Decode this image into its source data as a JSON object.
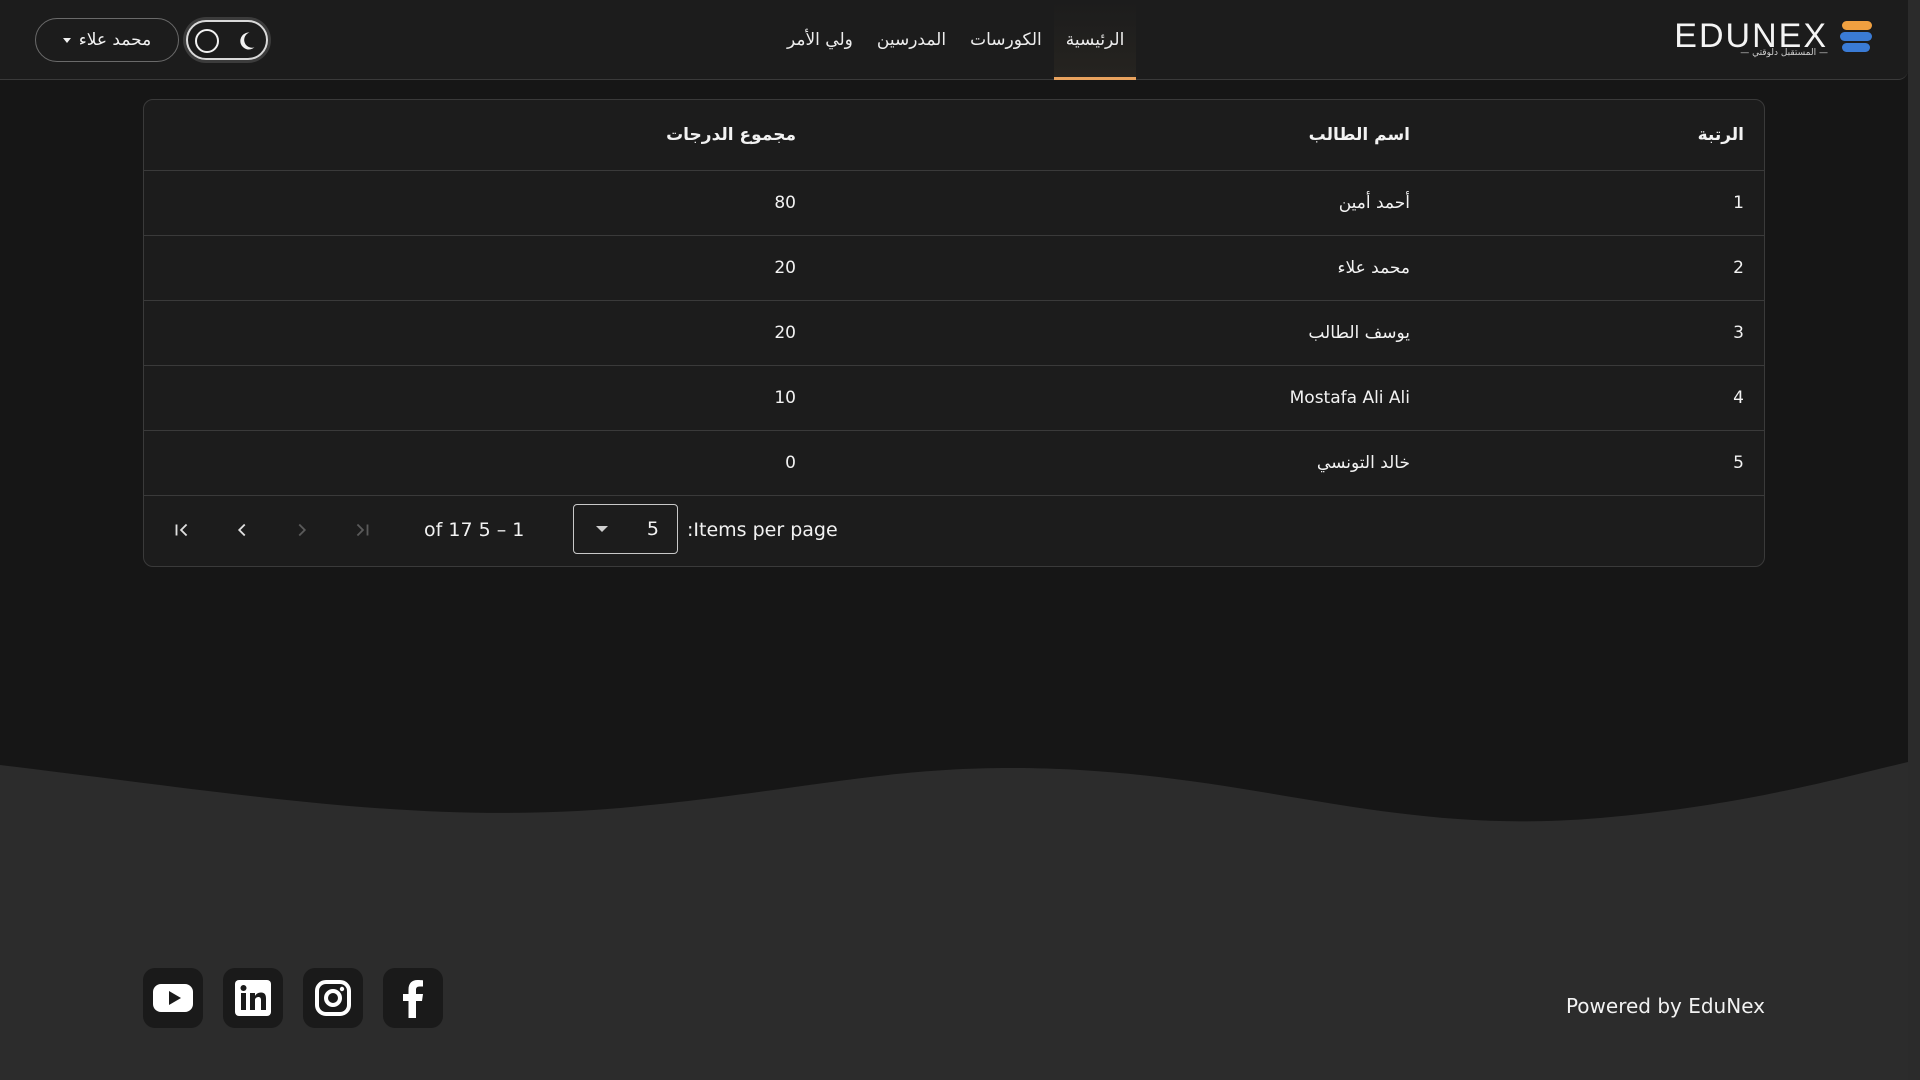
{
  "brand": {
    "name": "EDUNEX",
    "tagline": "المستقبل دلوقتي",
    "colors": {
      "accent": "#e8a25e",
      "blue": "#3a7bd5",
      "orange": "#f0a040"
    }
  },
  "nav": {
    "items": [
      {
        "label": "الرئيسية",
        "active": true
      },
      {
        "label": "الكورسات",
        "active": false
      },
      {
        "label": "المدرسين",
        "active": false
      },
      {
        "label": "ولي الأمر",
        "active": false
      }
    ]
  },
  "header": {
    "theme_toggle_icon": "moon-icon",
    "user_name": "محمد علاء"
  },
  "table": {
    "headers": {
      "rank": "الرتبة",
      "name": "اسم الطالب",
      "score": "مجموع الدرجات"
    },
    "rows": [
      {
        "rank": "1",
        "name": "أحمد أمين",
        "score": "80"
      },
      {
        "rank": "2",
        "name": "محمد علاء",
        "score": "20"
      },
      {
        "rank": "3",
        "name": "يوسف الطالب",
        "score": "20"
      },
      {
        "rank": "4",
        "name": "Mostafa Ali Ali",
        "score": "10"
      },
      {
        "rank": "5",
        "name": "خالد التونسي",
        "score": "0"
      }
    ]
  },
  "paginator": {
    "items_per_page_label": ":Items per page",
    "page_size": "5",
    "range_label": "of 17 5 – 1"
  },
  "footer": {
    "social_icons": [
      "youtube-icon",
      "linkedin-icon",
      "instagram-icon",
      "facebook-icon"
    ],
    "powered_by": "Powered by EduNex"
  }
}
